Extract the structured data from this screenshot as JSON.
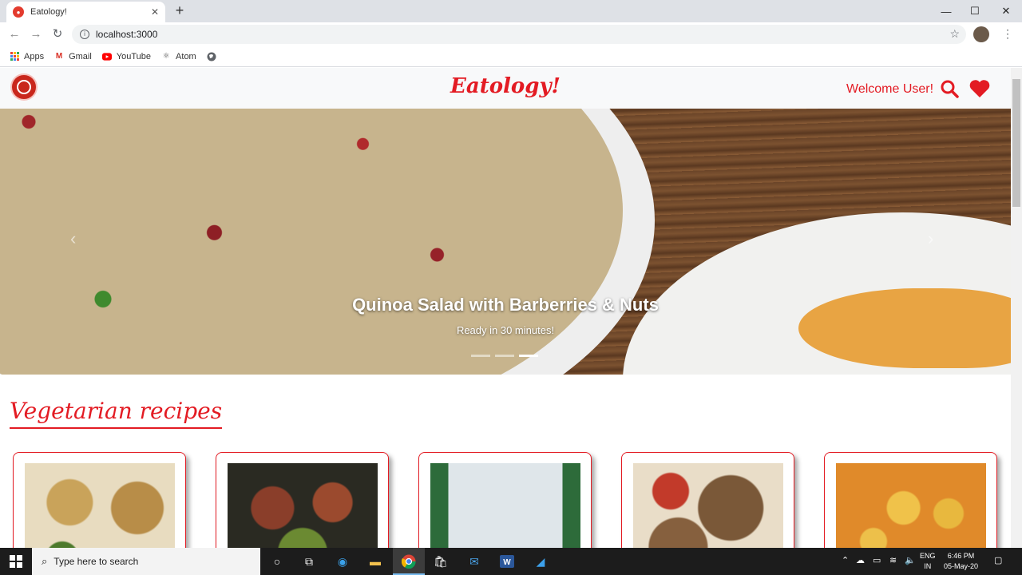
{
  "browser": {
    "tab_title": "Eatology!",
    "tab_close": "✕",
    "new_tab": "+",
    "url": "localhost:3000",
    "bookmarks": [
      {
        "label": "Apps",
        "icon": "apps-grid-icon"
      },
      {
        "label": "Gmail",
        "icon": "gmail-icon"
      },
      {
        "label": "YouTube",
        "icon": "youtube-icon"
      },
      {
        "label": "Atom",
        "icon": "atom-icon"
      }
    ],
    "window_controls": {
      "minimize": "—",
      "maximize": "☐",
      "close": "✕"
    }
  },
  "site": {
    "brand": "Eatology!",
    "welcome": "Welcome User!",
    "accent_color": "#e31b23"
  },
  "carousel": {
    "title": "Quinoa Salad with Barberries & Nuts",
    "subtitle": "Ready in 30 minutes!",
    "slide_count": 3,
    "active_slide": 3
  },
  "section": {
    "title": "Vegetarian recipes"
  },
  "recipes": [
    {
      "image": "muffins"
    },
    {
      "image": "tomato-bites"
    },
    {
      "image": "berry-tart"
    },
    {
      "image": "cookies"
    },
    {
      "image": "paneer-curry"
    }
  ],
  "taskbar": {
    "search_placeholder": "Type here to search",
    "lang_line1": "ENG",
    "lang_line2": "IN",
    "time": "6:46 PM",
    "date": "05-May-20"
  }
}
